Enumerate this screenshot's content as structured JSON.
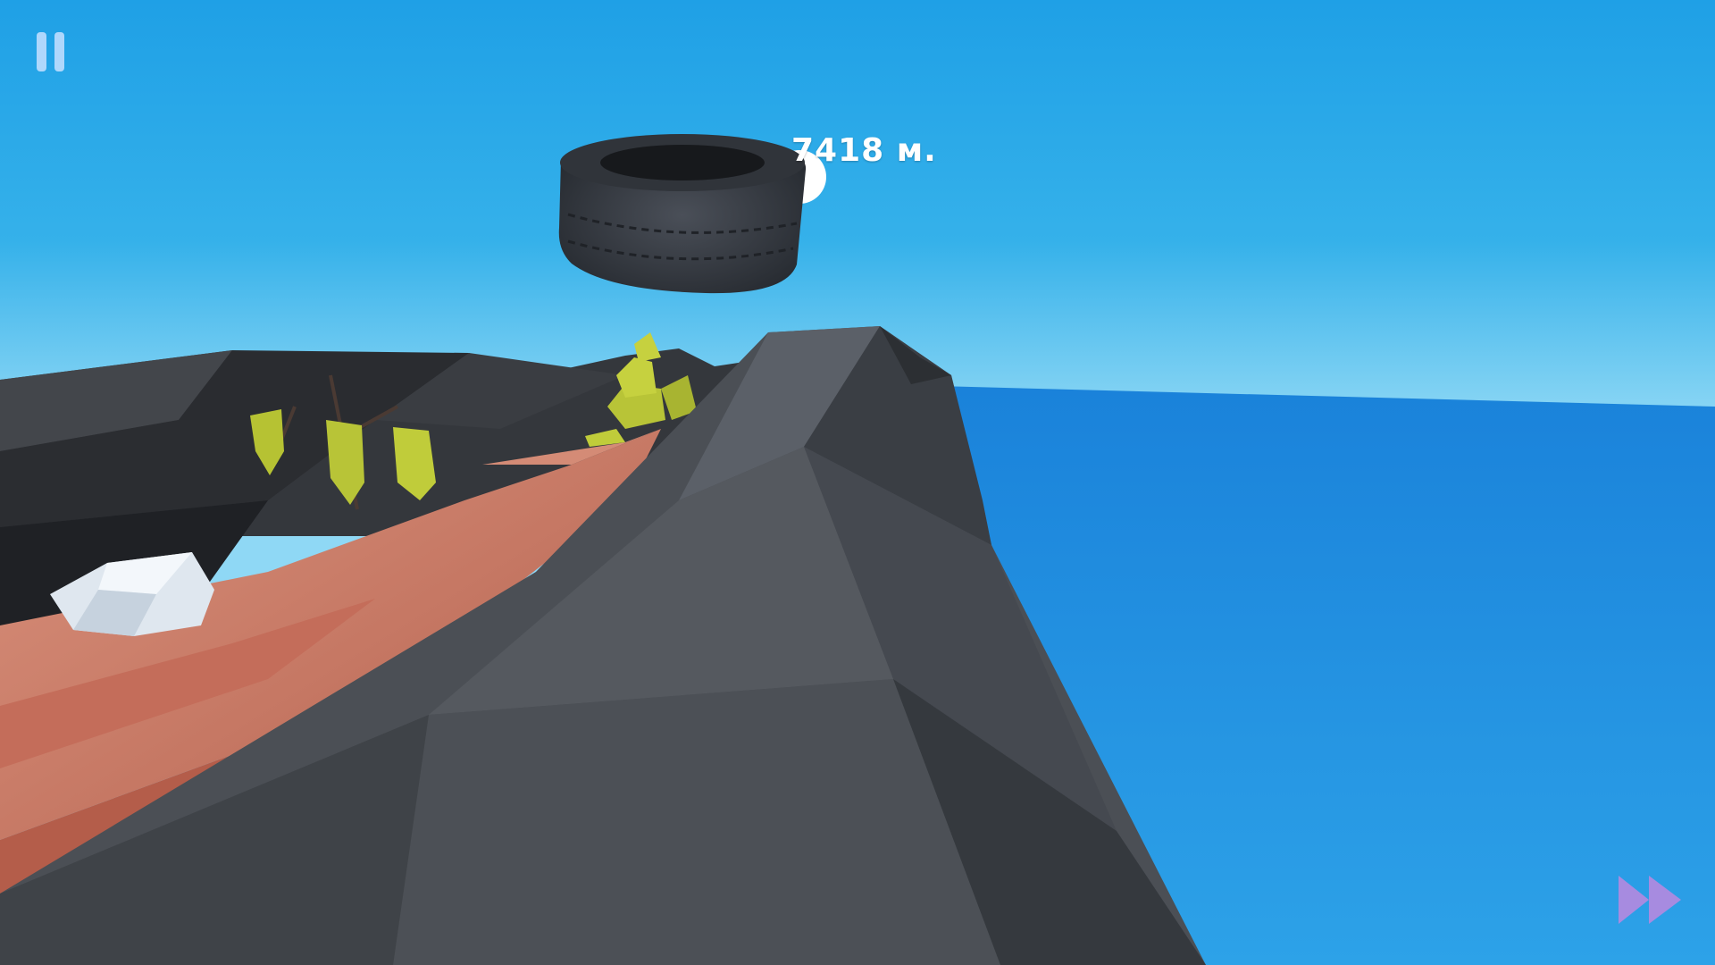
{
  "hud": {
    "distance_label": "7418 м.",
    "pause_icon": "pause-icon",
    "fast_forward_icon": "fast-forward-icon"
  },
  "colors": {
    "sky_top": "#1fa0e6",
    "sky_horizon": "#8fd8f5",
    "sea": "#1b88de",
    "rock": "#4a4e53",
    "dirt_path": "#c77362",
    "foliage": "#b8c437",
    "hud_icon": "#c8e1ff",
    "fast_forward": "#a78be0"
  }
}
